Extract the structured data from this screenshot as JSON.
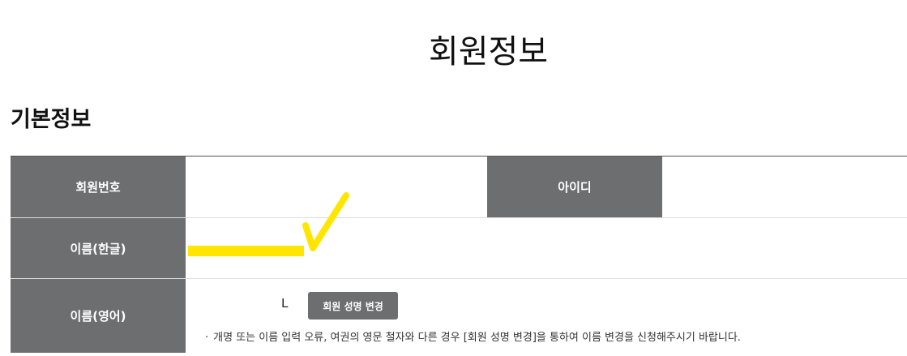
{
  "page": {
    "title": "회원정보"
  },
  "section": {
    "title": "기본정보"
  },
  "table": {
    "member_number_label": "회원번호",
    "id_label": "아이디",
    "name_korean_label": "이름(한글)",
    "name_english_label": "이름(영어)",
    "name_english_value": "L",
    "change_name_button": "회원 성명 변경",
    "notice_bullet": "·",
    "notice_text": "개명 또는 이름 입력 오류, 여권의 영문 철자와 다른 경우 [회원 성명 변경]을 통하여 이름 변경을 신청해주시기 바랍니다."
  },
  "colors": {
    "header_bg": "#6d6e70",
    "highlight": "#ffe500"
  }
}
